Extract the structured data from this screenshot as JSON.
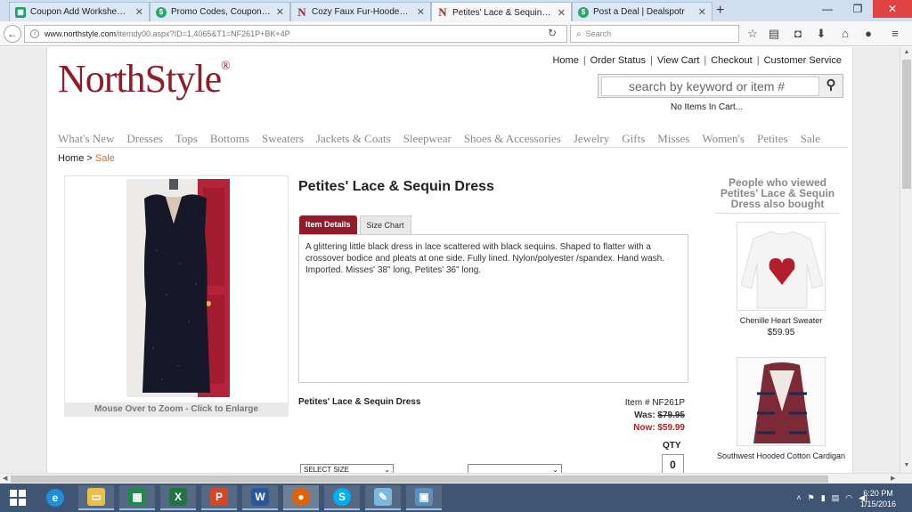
{
  "browser": {
    "tabs": [
      {
        "title": "Coupon Add Worksheet ...",
        "icon": "spreadsheet-icon",
        "active": false
      },
      {
        "title": "Promo Codes, Coupons &...",
        "icon": "dollar-icon",
        "active": false
      },
      {
        "title": "Cozy Faux Fur-Hooded Co...",
        "icon": "northstyle-icon",
        "active": false
      },
      {
        "title": "Petites' Lace & Sequin Dre...",
        "icon": "northstyle-icon",
        "active": true
      },
      {
        "title": "Post a Deal | Dealspotr",
        "icon": "dollar-icon",
        "active": false
      }
    ],
    "url_host": "www.northstyle.com",
    "url_path": "/itemdy00.aspx?ID=1,4065&T1=NF261P+BK+4P",
    "search_placeholder": "Search"
  },
  "site": {
    "logo": "NorthStyle",
    "logo_mark": "®",
    "top_links": [
      "Home",
      "Order Status",
      "View Cart",
      "Checkout",
      "Customer Service"
    ],
    "search_placeholder": "search by keyword or item #",
    "cart_status": "No Items In Cart...",
    "categories": [
      "What's New",
      "Dresses",
      "Tops",
      "Bottoms",
      "Sweaters",
      "Jackets & Coats",
      "Sleepwear",
      "Shoes & Accessories",
      "Jewelry",
      "Gifts",
      "Misses",
      "Women's",
      "Petites",
      "Sale"
    ],
    "breadcrumb": {
      "home": "Home",
      "sep": " > ",
      "current": "Sale"
    }
  },
  "product": {
    "title": "Petites' Lace & Sequin Dress",
    "zoom_hint": "Mouse Over to Zoom - Click to Enlarge",
    "tabs": [
      "Item Details",
      "Size Chart"
    ],
    "description": "A glittering little black dress in lace scattered with black sequins. Shaped to flatter with a crossover bodice and pleats at one side. Fully lined. Nylon/polyester /spandex. Hand wash. Imported. Misses' 38\" long, Petites' 36\" long.",
    "name_repeat": "Petites' Lace & Sequin Dress",
    "item_label": "Item #",
    "item_number": "NF261P",
    "was_label": "Was:",
    "was_price": "$79.95",
    "now_label": "Now:",
    "now_price": "$59.99",
    "qty_label": "QTY",
    "qty_value": "0",
    "size_select": "SELECT SIZE",
    "color_select": ""
  },
  "also_bought": {
    "heading": "People who viewed Petites' Lace & Sequin Dress also bought",
    "items": [
      {
        "name": "Chenille Heart Sweater",
        "price": "$59.95"
      },
      {
        "name": "Southwest Hooded Cotton Cardigan",
        "price": ""
      }
    ]
  },
  "taskbar": {
    "time": "6:20 PM",
    "date": "1/15/2016"
  },
  "colors": {
    "brand": "#8e1c2a",
    "sale": "#d06b2a",
    "now_price": "#b21e26",
    "taskbar": "#3e5573"
  }
}
